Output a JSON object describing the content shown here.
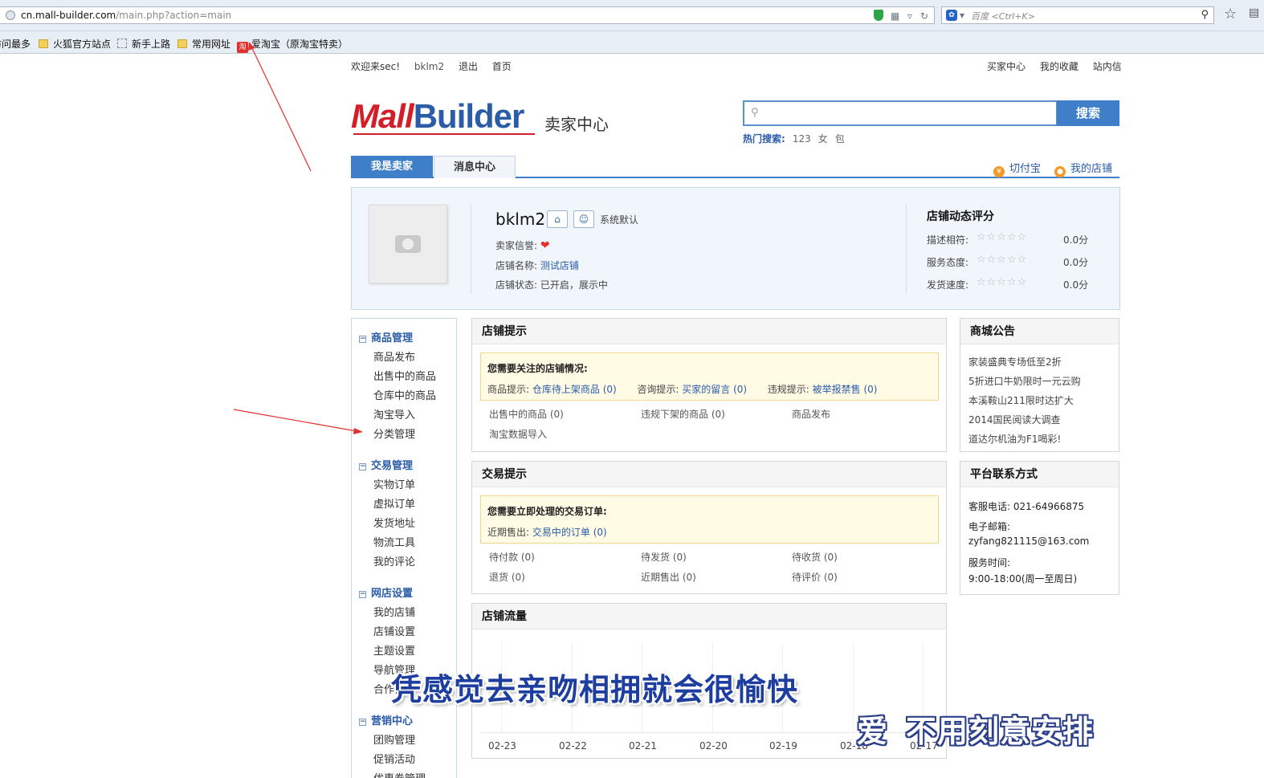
{
  "browser": {
    "url_host": "cn.mall-builder.com",
    "url_path": "/main.php?action=main",
    "search_placeholder": "百度 <Ctrl+K>",
    "bookmarks": [
      "访问最多",
      "火狐官方站点",
      "新手上路",
      "常用网址",
      "爱淘宝（原淘宝特卖）"
    ]
  },
  "topbar": {
    "welcome": "欢迎来sec!",
    "user": "bklm2",
    "logout": "退出",
    "home": "首页",
    "right_links": [
      "买家中心",
      "我的收藏",
      "站内信"
    ]
  },
  "header": {
    "logo_m": "M",
    "logo_rest1": "all",
    "logo_rest2": "Builder",
    "center_title": "卖家中心",
    "search_button": "搜索",
    "hot_label": "热门搜索:",
    "hot_terms": [
      "123",
      "女",
      "包"
    ]
  },
  "tabs": [
    "我是卖家",
    "消息中心"
  ],
  "tab_links": [
    "切付宝",
    "我的店铺"
  ],
  "shop": {
    "name": "bklm2",
    "default_label": "系统默认",
    "credit_label": "卖家信誉:",
    "name_label": "店铺名称:",
    "name_value": "测试店铺",
    "status_label": "店铺状态:",
    "status_value": "已开启，展示中"
  },
  "rating": {
    "title": "店铺动态评分",
    "rows": [
      {
        "label": "描述相符:",
        "score": "0.0分",
        "stars": 0
      },
      {
        "label": "服务态度:",
        "score": "0.0分",
        "stars": 0
      },
      {
        "label": "发货速度:",
        "score": "0.0分",
        "stars": 0
      }
    ]
  },
  "menu": [
    {
      "title": "商品管理",
      "items": [
        "商品发布",
        "出售中的商品",
        "仓库中的商品",
        "淘宝导入",
        "分类管理"
      ]
    },
    {
      "title": "交易管理",
      "items": [
        "实物订单",
        "虚拟订单",
        "发货地址",
        "物流工具",
        "我的评论"
      ]
    },
    {
      "title": "网店设置",
      "items": [
        "我的店铺",
        "店铺设置",
        "主题设置",
        "导航管理",
        "合作伙伴"
      ]
    },
    {
      "title": "营销中心",
      "items": [
        "团购管理",
        "促销活动",
        "优惠券管理"
      ]
    }
  ],
  "shop_tips": {
    "title": "店铺提示",
    "notice_title": "您需要关注的店铺情况:",
    "goods_label": "商品提示:",
    "goods_link": "仓库待上架商品",
    "goods_count": "(0)",
    "consult_label": "咨询提示:",
    "consult_link": "买家的留言",
    "consult_count": "(0)",
    "violation_label": "违规提示:",
    "violation_link": "被举报禁售",
    "violation_count": "(0)",
    "cells": [
      "出售中的商品 (0)",
      "违规下架的商品 (0)",
      "商品发布",
      "淘宝数据导入"
    ]
  },
  "trade_tips": {
    "title": "交易提示",
    "notice_title": "您需要立即处理的交易订单:",
    "recent_label": "近期售出:",
    "recent_link": "交易中的订单",
    "recent_count": "(0)",
    "cells": [
      "待付款 (0)",
      "待发货 (0)",
      "待收货 (0)",
      "退货 (0)",
      "近期售出 (0)",
      "待评价 (0)"
    ]
  },
  "traffic": {
    "title": "店铺流量",
    "x_labels": [
      "02-23",
      "02-22",
      "02-21",
      "02-20",
      "02-19",
      "02-18",
      "02-17"
    ]
  },
  "announcements": {
    "title": "商城公告",
    "items": [
      "家装盛典专场低至2折",
      "5折进口牛奶限时一元云购",
      "本溪鞍山211限时达扩大",
      "2014国民阅读大调查",
      "道达尔机油为F1喝彩!"
    ]
  },
  "contact": {
    "title": "平台联系方式",
    "phone_label": "客服电话:",
    "phone": "021-64966875",
    "email_label": "电子邮箱:",
    "email": "zyfang821115@163.com",
    "hours_label": "服务时间:",
    "hours": "9:00-18:00(周一至周日)"
  },
  "subtitles": {
    "line1": "凭感觉去亲吻相拥就会很愉快",
    "line2a": "爱",
    "line2b": "不用刻意安排"
  },
  "colors": {
    "accent": "#3f7ec9",
    "link": "#2a5ca8",
    "logo_red": "#d31f27",
    "notice_bg": "#fffbe5"
  }
}
